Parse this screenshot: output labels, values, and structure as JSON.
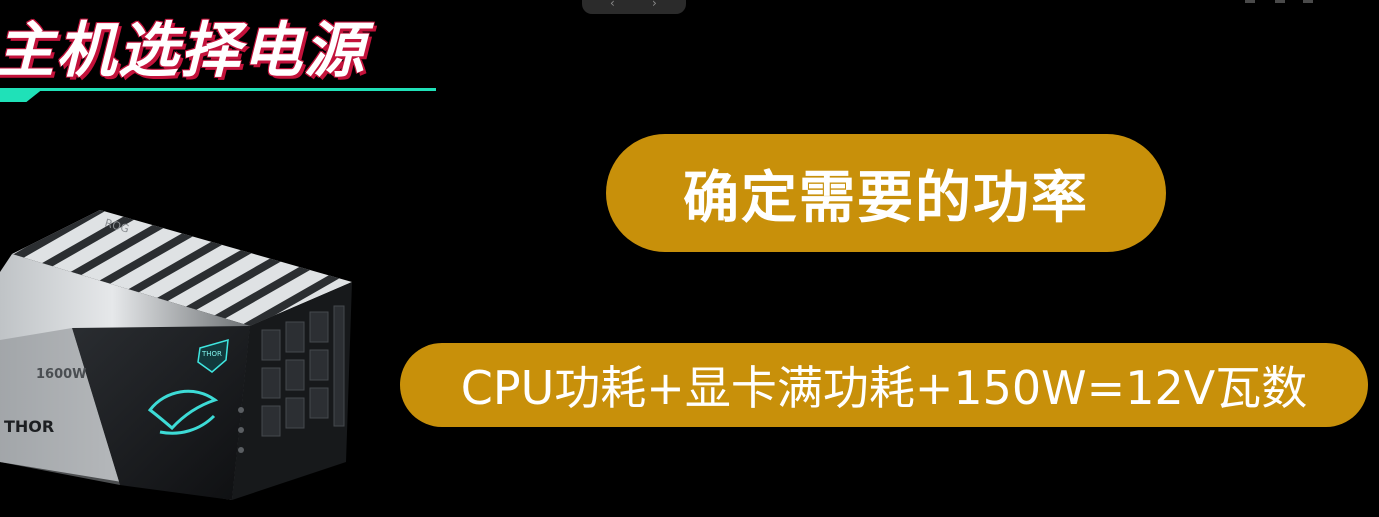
{
  "header": {
    "title": "主机选择电源"
  },
  "main": {
    "heading_pill": "确定需要的功率",
    "formula_pill": "CPU功耗+显卡满功耗+150W=12V瓦数"
  },
  "product": {
    "brand_logo": "ROG",
    "wattage_label": "1600W",
    "model_text": "THOR",
    "badge_text": "THOR"
  },
  "colors": {
    "background": "#000000",
    "pill": "#c8900a",
    "accent": "#1fe1b8",
    "title_shadow": "#c3123b",
    "led": "#3fe6e0"
  },
  "icons": {
    "rog_eye": "rog-eye-icon"
  }
}
